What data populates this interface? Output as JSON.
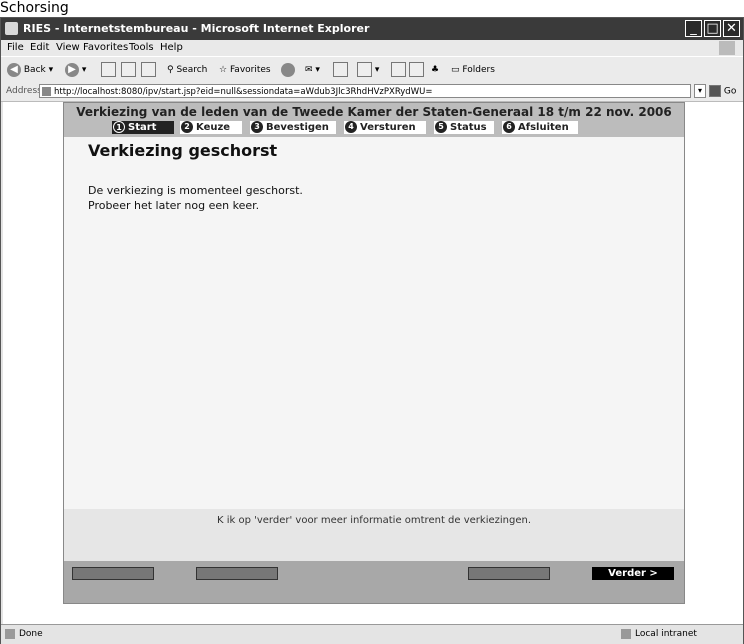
{
  "caption": "Schorsing",
  "window": {
    "title": "RIES - Internetstembureau - Microsoft Internet Explorer",
    "controls": {
      "minimize": "_",
      "maximize": "□",
      "close": "✕"
    }
  },
  "menu": [
    "File",
    "Edit",
    "View",
    "Favorites",
    "Tools",
    "Help"
  ],
  "toolbar": {
    "back": "Back",
    "search": "Search",
    "favorites": "Favorites",
    "folders": "Folders"
  },
  "address": {
    "label": "Address",
    "url": "http://localhost:8080/ipv/start.jsp?eid=null&sessiondata=aWdub3Jlc3RhdHVzPXRydWU=",
    "go": "Go"
  },
  "page": {
    "title": "Verkiezing van de leden van de Tweede Kamer der Staten-Generaal 18 t/m 22 nov. 2006",
    "steps": [
      {
        "num": "1",
        "label": "Start"
      },
      {
        "num": "2",
        "label": "Keuze"
      },
      {
        "num": "3",
        "label": "Bevestigen"
      },
      {
        "num": "4",
        "label": "Versturen"
      },
      {
        "num": "5",
        "label": "Status"
      },
      {
        "num": "6",
        "label": "Afsluiten"
      }
    ],
    "active_step": 1,
    "heading": "Verkiezing geschorst",
    "message_line1": "De verkiezing is momenteel geschorst.",
    "message_line2": "Probeer het later nog een keer.",
    "info": "K ik op 'verder' voor meer informatie omtrent de verkiezingen.",
    "next_button": "Verder >"
  },
  "status": {
    "left": "Done",
    "right": "Local intranet"
  }
}
